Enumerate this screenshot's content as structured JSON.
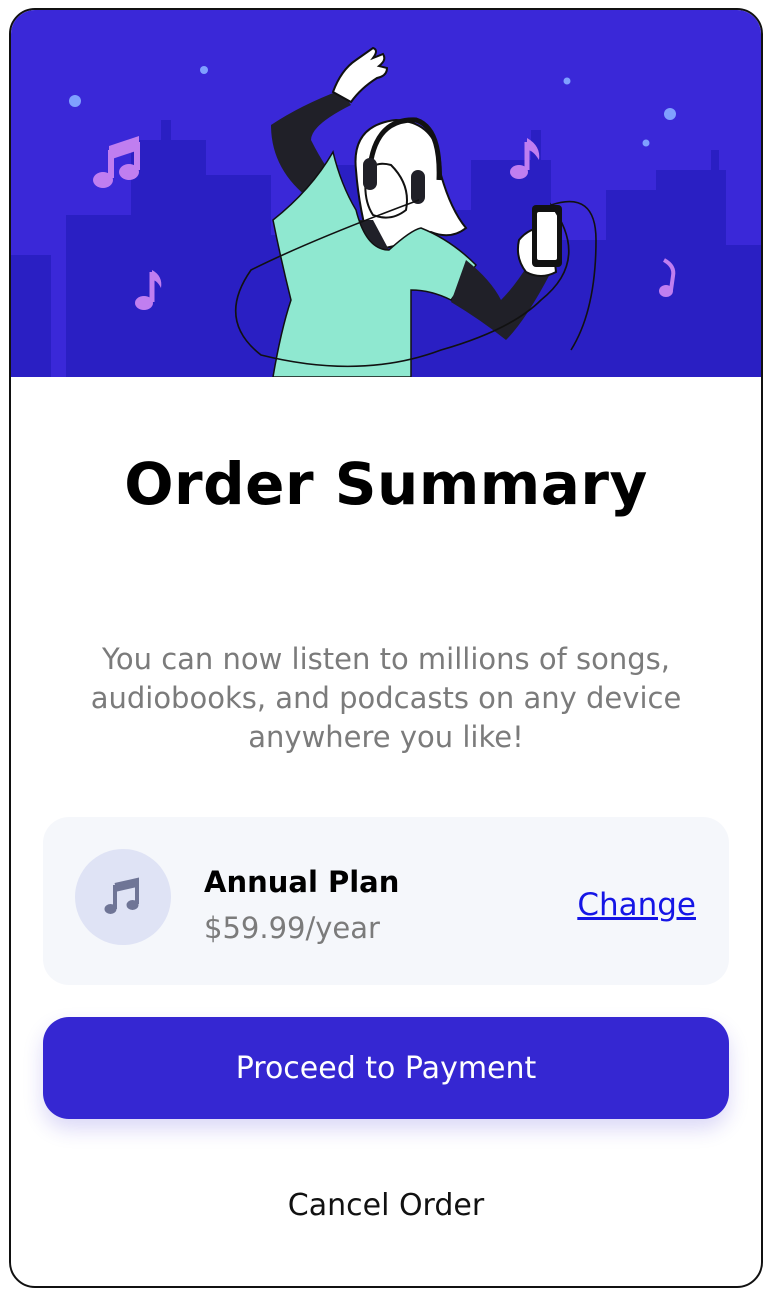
{
  "colors": {
    "hero_background": "#3a28d8",
    "skyline": "#2a1fc3",
    "primary_button": "#3527d2",
    "link": "#1515e6",
    "muted_text": "#7b7b7b",
    "plan_background": "#f5f7fb",
    "note": "#c07ef0",
    "shirt": "#8fe8d0"
  },
  "hero": {
    "illustration": "person-dancing-with-headphones-illustration"
  },
  "title": "Order Summary",
  "description": "You can now listen to millions of songs, audiobooks, and podcasts on any device anywhere you like!",
  "plan": {
    "icon": "music-note-icon",
    "name": "Annual Plan",
    "price": "$59.99/year",
    "change_label": "Change"
  },
  "actions": {
    "proceed_label": "Proceed to Payment",
    "cancel_label": "Cancel Order"
  }
}
